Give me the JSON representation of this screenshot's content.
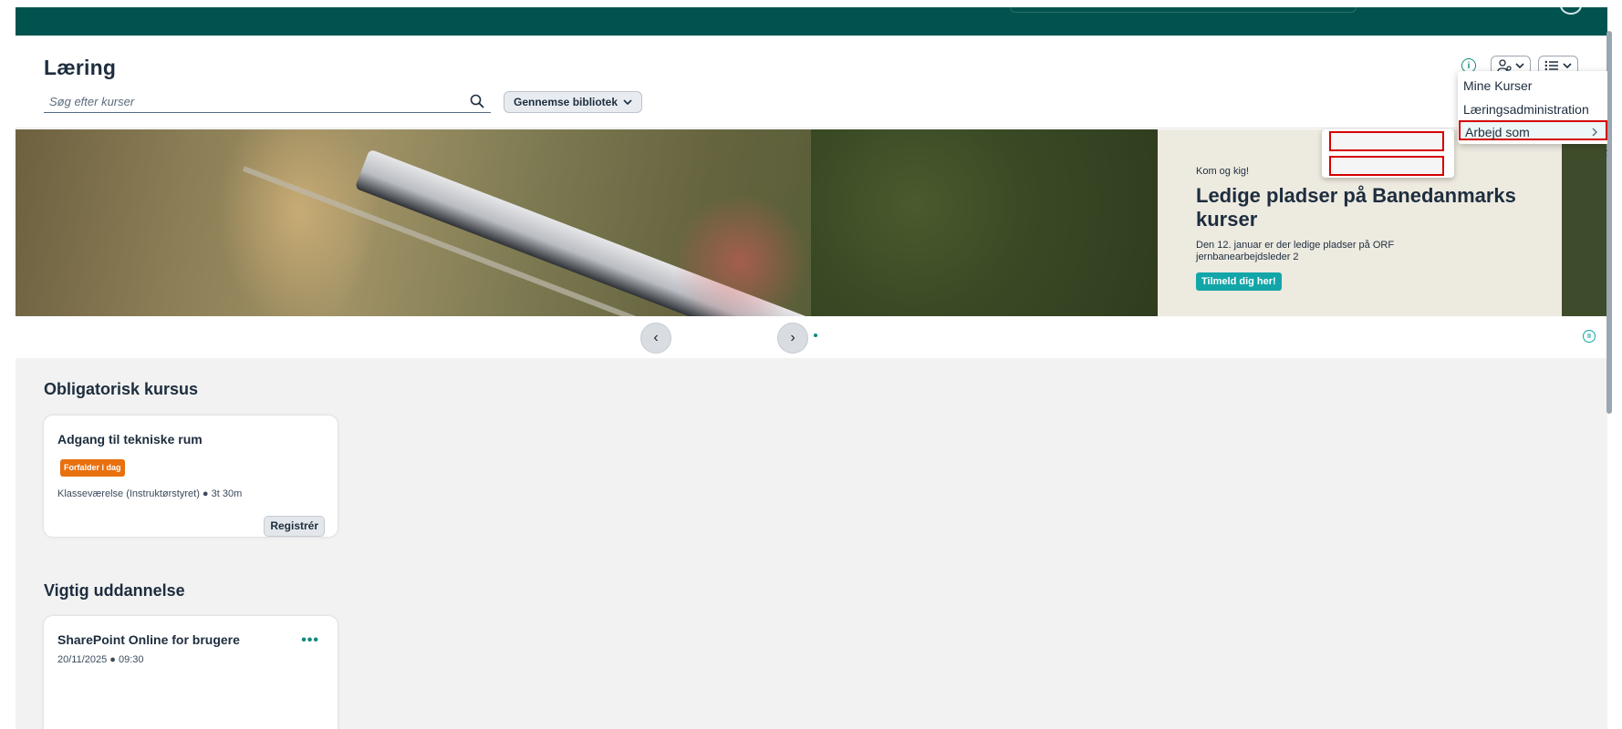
{
  "header": {
    "title": "Læring",
    "search_placeholder": "Søg efter kurser",
    "browse_label": "Gennemse bibliotek"
  },
  "menu": {
    "items": [
      "Mine Kurser",
      "Læringsadministration",
      "Arbejd som"
    ]
  },
  "banner": {
    "kicker": "Kom og kig!",
    "headline": "Ledige pladser på Banedanmarks kurser",
    "description": "Den 12. januar er der ledige pladser på ORF jernbanearbejdsleder 2",
    "cta": "Tilmeld dig her!"
  },
  "carousel": {
    "prev": "‹",
    "next": "›",
    "dots": 3,
    "active_dot": 2
  },
  "sections": {
    "mandatory": {
      "title": "Obligatorisk kursus",
      "card": {
        "title": "Adgang til tekniske rum",
        "badge": "Forfalder i dag",
        "meta": "Klasseværelse (Instruktørstyret) ● 3t 30m",
        "action": "Registrér"
      }
    },
    "important": {
      "title": "Vigtig uddannelse",
      "card": {
        "title": "SharePoint Online for brugere",
        "meta": "20/11/2025 ● 09:30",
        "more": "•••"
      }
    }
  },
  "colors": {
    "brand": "#00534f",
    "accent": "#13a6a9",
    "badge": "#e8700f",
    "highlight_border": "#d40000"
  }
}
